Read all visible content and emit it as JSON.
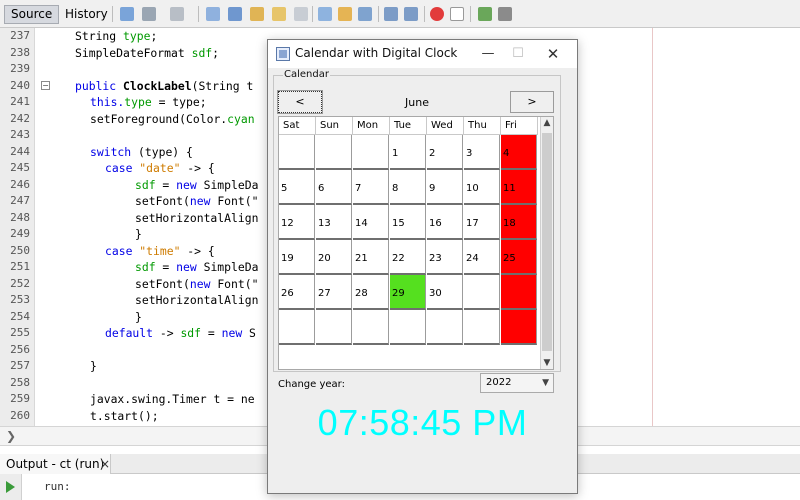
{
  "ide": {
    "tabs": {
      "source": "Source",
      "history": "History"
    },
    "line_numbers": [
      "237",
      "238",
      "239",
      "240",
      "241",
      "242",
      "243",
      "244",
      "245",
      "246",
      "247",
      "248",
      "249",
      "250",
      "251",
      "252",
      "253",
      "254",
      "255",
      "256",
      "257",
      "258",
      "259",
      "260"
    ],
    "code": {
      "l237": [
        "String ",
        "type",
        ";"
      ],
      "l238": [
        "SimpleDateFormat ",
        "sdf",
        ";"
      ],
      "l240": [
        "public ",
        "ClockLabel",
        "(String t"
      ],
      "l241": [
        "this.",
        "type",
        " = type;"
      ],
      "l242": [
        "setForeground(Color.",
        "cyan"
      ],
      "l244": [
        "switch ",
        "(type) {"
      ],
      "l245": [
        "case ",
        "\"date\"",
        " -> {"
      ],
      "l246": [
        "sdf",
        " = ",
        "new ",
        "SimpleDa"
      ],
      "l247": [
        "setFont(",
        "new ",
        "Font(\""
      ],
      "l248": [
        "setHorizontalAlign"
      ],
      "l249": [
        "}"
      ],
      "l250": [
        "case ",
        "\"time\"",
        " -> {"
      ],
      "l251": [
        "sdf",
        " = ",
        "new ",
        "SimpleDa"
      ],
      "l252": [
        "setFont(",
        "new ",
        "Font(\""
      ],
      "l253": [
        "setHorizontalAlign"
      ],
      "l254": [
        "}"
      ],
      "l255": [
        "default",
        " -> ",
        "sdf",
        " = ",
        "new ",
        "S"
      ],
      "l257": [
        "}"
      ],
      "l259": [
        "javax.swing.Timer t = ne"
      ],
      "l260": [
        "t.start();"
      ]
    },
    "output": {
      "tab_label": "Output - ct (run)",
      "close": "×",
      "text": "run:"
    }
  },
  "window": {
    "title": "Calendar with Digital Clock",
    "controls": {
      "minimize": "—",
      "maximize": "☐",
      "close": "✕"
    },
    "calendar_legend": "Calendar",
    "prev_label": "<",
    "next_label": ">",
    "month": "June",
    "weekdays": [
      "Sat",
      "Sun",
      "Mon",
      "Tue",
      "Wed",
      "Thu",
      "Fri"
    ],
    "weeks": [
      [
        "",
        "",
        "",
        "1",
        "2",
        "3",
        "4"
      ],
      [
        "5",
        "6",
        "7",
        "8",
        "9",
        "10",
        "11"
      ],
      [
        "12",
        "13",
        "14",
        "15",
        "16",
        "17",
        "18"
      ],
      [
        "19",
        "20",
        "21",
        "22",
        "23",
        "24",
        "25"
      ],
      [
        "26",
        "27",
        "28",
        "29",
        "30",
        "",
        ""
      ],
      [
        "",
        "",
        "",
        "",
        "",
        "",
        ""
      ]
    ],
    "highlight_colors": {
      "friday": "#ff0000",
      "today": "#55e01f"
    },
    "change_year_label": "Change year:",
    "year_value": "2022",
    "clock_time": "07:58:45 PM",
    "clock_color": "#00ffff"
  }
}
